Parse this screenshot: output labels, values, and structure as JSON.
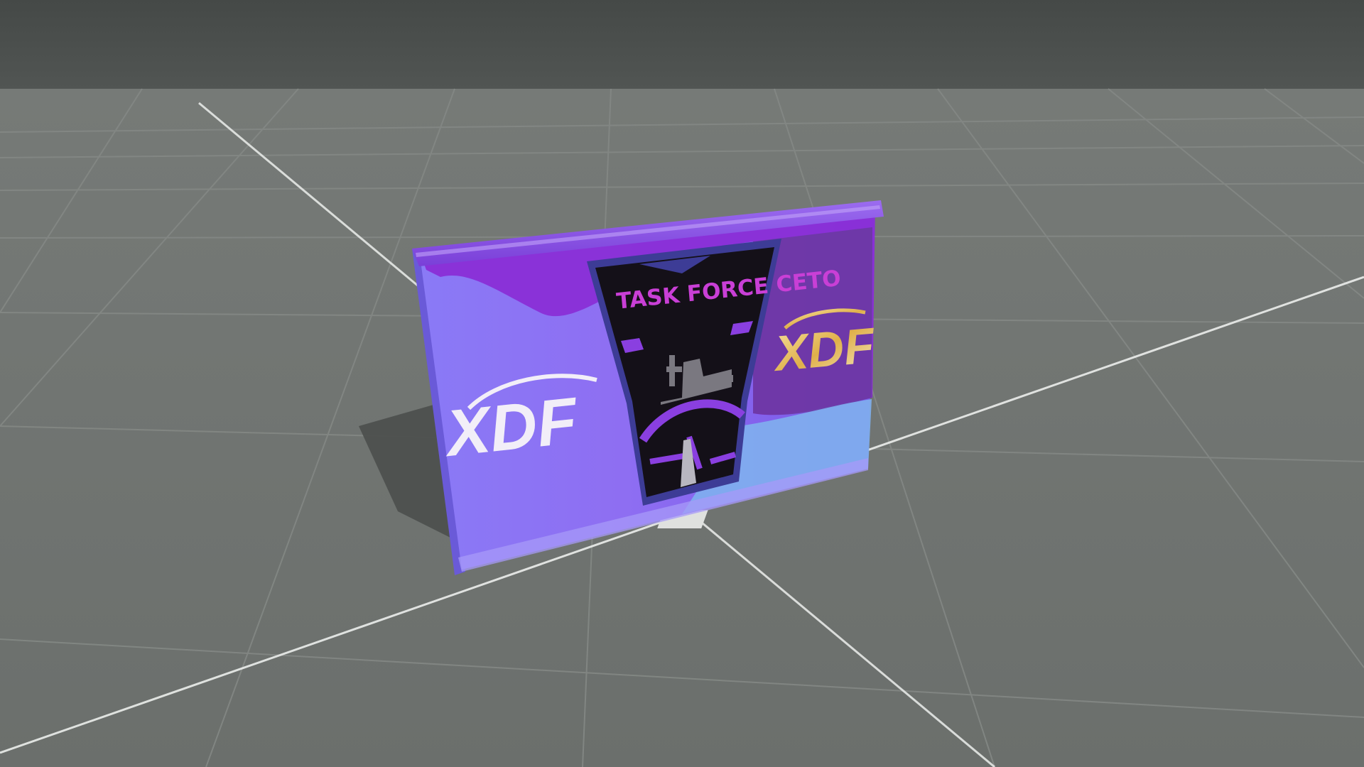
{
  "scene": {
    "colors": {
      "sky": "#4a4e4b",
      "ground": "#717572",
      "grid_line": "#8a8e8a",
      "axis_line": "#e8eae8",
      "banner_light": "#8f7cf5",
      "banner_dark": "#7b1fd0",
      "banner_blue": "#7fb2f0",
      "emblem_fill": "#141018",
      "emblem_border": "#3e3d9a",
      "emblem_text": "#c93fd6",
      "emblem_accent": "#8a3fe0",
      "logo_white": "#f2eef8",
      "logo_gold": "#e8c25a"
    }
  },
  "banner": {
    "emblem_title": "TASK FORCE CETO",
    "logo_left": "XDF",
    "logo_right": "XDF"
  }
}
